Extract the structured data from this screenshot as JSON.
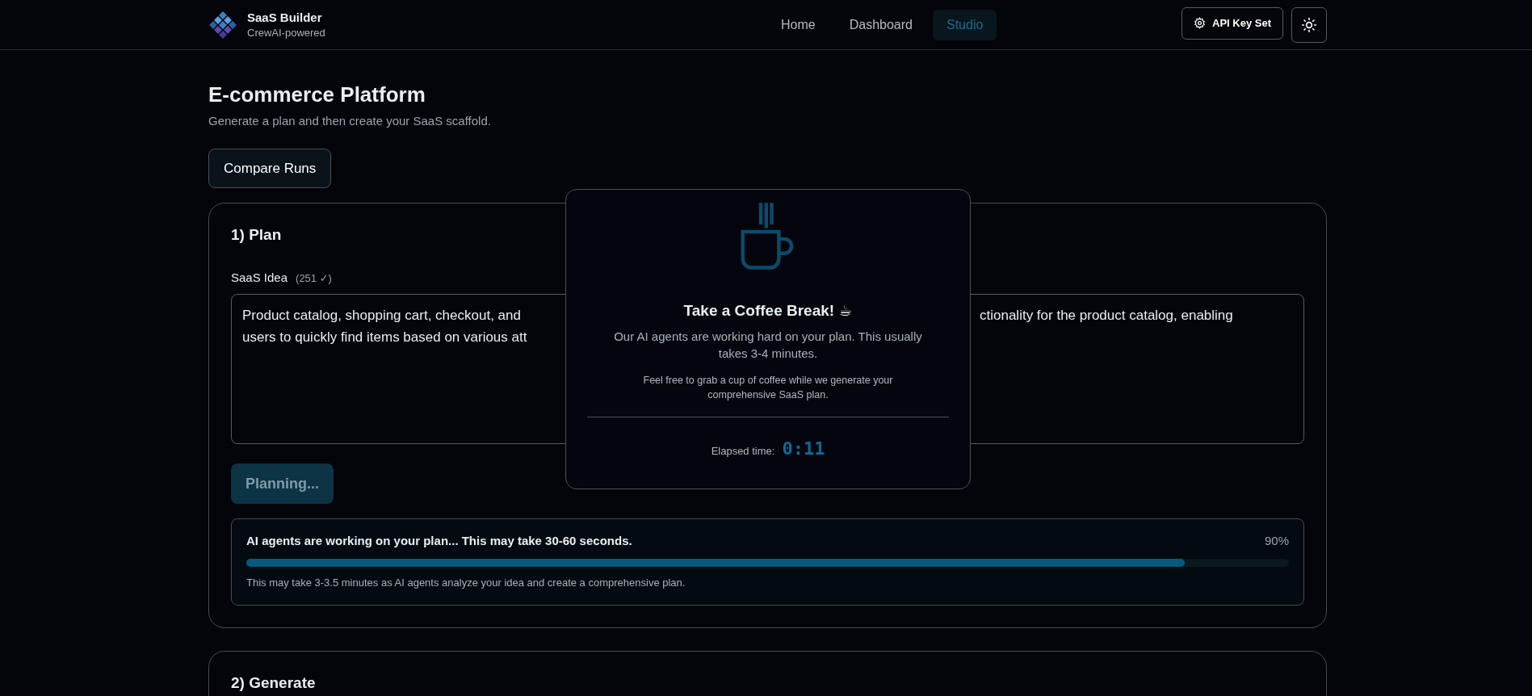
{
  "brand": {
    "title": "SaaS Builder",
    "subtitle": "CrewAI-powered"
  },
  "nav": [
    {
      "label": "Home",
      "selected": false
    },
    {
      "label": "Dashboard",
      "selected": false
    },
    {
      "label": "Studio",
      "selected": true
    }
  ],
  "api_key_button": "API Key Set",
  "page": {
    "title": "E-commerce Platform",
    "subtitle": "Generate a plan and then create your SaaS scaffold."
  },
  "compare_button": "Compare Runs",
  "plan": {
    "title": "1) Plan",
    "idea_label": "SaaS Idea",
    "idea_count": "(251 ✓)",
    "idea_visible_left": [
      "Product catalog, shopping cart, checkout, and",
      "users to quickly find items based on various att"
    ],
    "idea_visible_right": [
      "ctionality for the product catalog, enabling"
    ],
    "plan_button": {
      "label": "Planning...",
      "disabled": true
    },
    "progress": {
      "message": "AI agents are working on your plan... This may take 30-60 seconds.",
      "percent": "90%",
      "level": 0.9,
      "note": "This may take 3-3.5 minutes as AI agents analyze your idea and create a comprehensive plan."
    }
  },
  "generate": {
    "title": "2) Generate"
  },
  "modal": {
    "title": "Take a Coffee Break! ☕",
    "text": "Our AI agents are working hard on your plan. This usually takes 3-4 minutes.",
    "note": "Feel free to grab a cup of coffee while we generate your comprehensive SaaS plan.",
    "elapsed_label": "Elapsed time:",
    "elapsed": "0:11"
  }
}
